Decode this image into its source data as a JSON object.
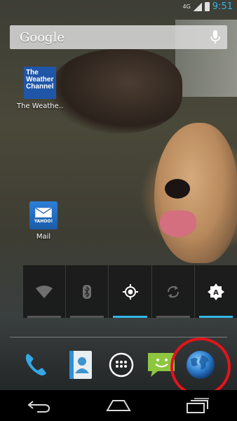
{
  "status_bar": {
    "network": "4G",
    "time": "9:51"
  },
  "search": {
    "label": "Google",
    "mic_icon": "mic-icon"
  },
  "home_apps": [
    {
      "label": "The Weathe..",
      "icon": "weather-channel-icon",
      "icon_text": [
        "The",
        "Weather",
        "Channel"
      ]
    },
    {
      "label": "Mail",
      "icon": "yahoo-mail-icon",
      "icon_text": "YAHOO!"
    }
  ],
  "quick_settings": [
    {
      "name": "wifi",
      "icon": "wifi-icon",
      "state": "off"
    },
    {
      "name": "bluetooth",
      "icon": "bluetooth-icon",
      "state": "off"
    },
    {
      "name": "gps",
      "icon": "gps-icon",
      "state": "on"
    },
    {
      "name": "sync",
      "icon": "sync-icon",
      "state": "off"
    },
    {
      "name": "auto-brightness",
      "icon": "auto-brightness-icon",
      "state": "on",
      "icon_text": "A"
    }
  ],
  "dock": [
    {
      "name": "phone",
      "icon": "phone-icon"
    },
    {
      "name": "contacts",
      "icon": "contacts-icon"
    },
    {
      "name": "all-apps",
      "icon": "app-drawer-icon"
    },
    {
      "name": "messaging",
      "icon": "messaging-icon"
    },
    {
      "name": "browser",
      "icon": "browser-globe-icon",
      "highlighted": true
    }
  ],
  "navigation": [
    {
      "name": "back",
      "icon": "back-icon"
    },
    {
      "name": "home",
      "icon": "home-icon"
    },
    {
      "name": "recents",
      "icon": "recents-icon"
    }
  ],
  "colors": {
    "accent": "#33b5e5",
    "highlight": "#e3141b"
  }
}
